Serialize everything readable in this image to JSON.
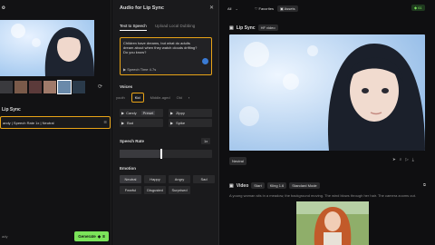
{
  "left": {
    "title": "o",
    "section_label": "Lip Sync",
    "selection_text": "andy | Speech Rate 1x | Neutral",
    "footer_label": "ady",
    "generate_label": "Generate",
    "generate_credits": "8"
  },
  "middle": {
    "title": "Audio for Lip Sync",
    "tabs": [
      "Text to Speech",
      "Upload Local Dubbing"
    ],
    "script_text": "Children have dreams, but what do adults dream about when they watch clouds drifting? Do you know?",
    "speech_time": "Speech Time 4.7s",
    "voices_label": "Voices",
    "voice_filters": [
      "youth",
      "Kid",
      "Middle-aged",
      "Old"
    ],
    "voices": [
      {
        "name": "Candy",
        "tag": "Preset"
      },
      {
        "name": "Zippy"
      },
      {
        "name": "Bud"
      },
      {
        "name": "Spike"
      }
    ],
    "speech_rate_label": "Speech Rate",
    "speech_rate_value": "1x",
    "speech_rate_level": 0.45,
    "emotion_label": "Emotion",
    "emotions": [
      "Neutral",
      "Happy",
      "Angry",
      "Sad",
      "Fearful",
      "Disgusted",
      "Surprised"
    ]
  },
  "right": {
    "filter_all": "All",
    "favorites": "Favorites",
    "assets": "Assets",
    "credits": "61",
    "lip_sync_title": "Lip Sync",
    "lip_sync_badge": "HF video",
    "lip_sync_tag": "Neutral",
    "video_title": "Video",
    "video_chips": [
      "Start",
      "Kling 1.6",
      "Standard Mode"
    ],
    "video_caption": "A young woman sits in a meadow, the background moving. The wind blows through her hair. The camera zooms out."
  },
  "colors": {
    "accent": "#e8a317",
    "green": "#7be35a",
    "panel": "#1a1a1c"
  }
}
